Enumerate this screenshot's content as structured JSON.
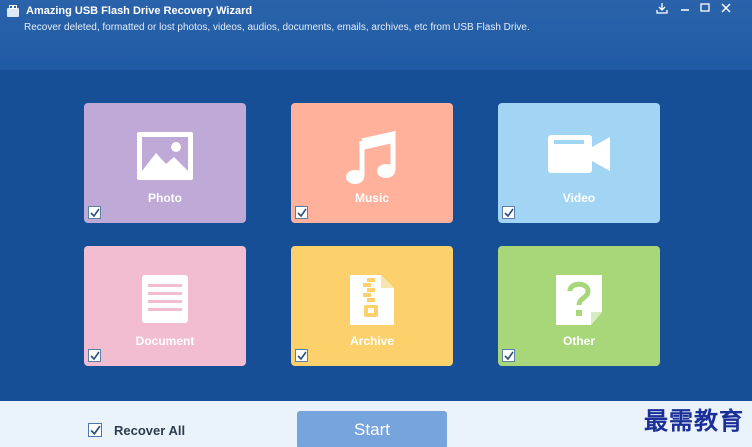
{
  "window": {
    "title": "Amazing USB Flash Drive Recovery Wizard",
    "subtitle": "Recover deleted, formatted or lost photos, videos, audios, documents, emails, archives, etc from USB Flash Drive."
  },
  "controls": [
    "save-icon",
    "minimize-icon",
    "restore-icon",
    "close-icon"
  ],
  "tiles": [
    {
      "label": "Photo",
      "icon": "photo-icon",
      "color": "#bfa9d6",
      "checked": true
    },
    {
      "label": "Music",
      "icon": "music-note-icon",
      "color": "#ffb19c",
      "checked": true
    },
    {
      "label": "Video",
      "icon": "video-camera-icon",
      "color": "#a2d5f3",
      "checked": true
    },
    {
      "label": "Document",
      "icon": "document-icon",
      "color": "#f2bdd0",
      "checked": true
    },
    {
      "label": "Archive",
      "icon": "archive-zip-icon",
      "color": "#fcd16c",
      "checked": true
    },
    {
      "label": "Other",
      "icon": "question-file-icon",
      "color": "#a7d779",
      "checked": true
    }
  ],
  "footer": {
    "recover_all_label": "Recover All",
    "recover_all_checked": true,
    "start_label": "Start"
  },
  "watermark": "最需教育",
  "colors": {
    "titlebar": "#2561a8",
    "background": "#164f96",
    "footer": "#eaf3fb",
    "start_button": "#77a4dc"
  }
}
